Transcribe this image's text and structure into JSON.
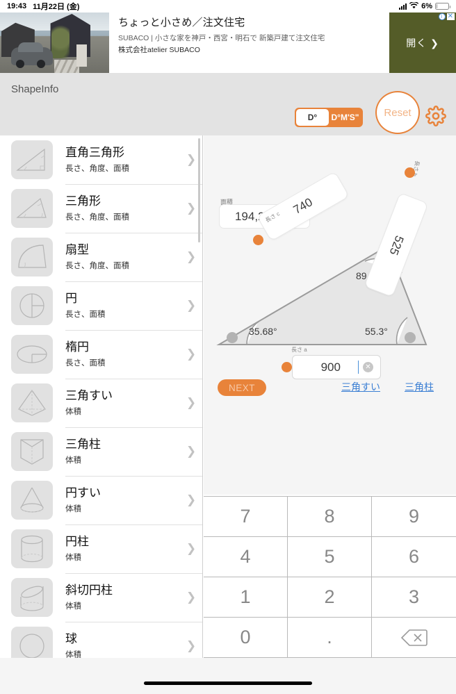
{
  "status_bar": {
    "time": "19:43",
    "date": "11月22日 (金)",
    "battery_percent": "6%",
    "signal_icon": "cellular-signal-icon",
    "wifi_icon": "wifi-icon",
    "battery_icon": "battery-icon"
  },
  "ad": {
    "title": "ちょっと小さめ／注文住宅",
    "description": "SUBACO | 小さな家を神戸・西宮・明石で 新築戸建て注文住宅",
    "advertiser": "株式会社atelier SUBACO",
    "cta_label": "開く ❯",
    "info_badge": "i",
    "close_badge": "✕",
    "cta_color": "#545c28"
  },
  "header": {
    "app_title": "ShapeInfo",
    "angle_mode": {
      "options": [
        "D°",
        "D°M'S\""
      ],
      "selected": "D°"
    },
    "reset_label": "Reset",
    "settings_icon": "gear-icon",
    "accent_color": "#e8833a"
  },
  "sidebar": {
    "items": [
      {
        "title": "直角三角形",
        "subtitle": "長さ、角度、面積",
        "icon": "right-triangle-icon"
      },
      {
        "title": "三角形",
        "subtitle": "長さ、角度、面積",
        "icon": "triangle-icon"
      },
      {
        "title": "扇型",
        "subtitle": "長さ、角度、面積",
        "icon": "sector-icon"
      },
      {
        "title": "円",
        "subtitle": "長さ、面積",
        "icon": "circle-icon"
      },
      {
        "title": "楕円",
        "subtitle": "長さ、面積",
        "icon": "ellipse-icon"
      },
      {
        "title": "三角すい",
        "subtitle": "体積",
        "icon": "triangular-pyramid-icon"
      },
      {
        "title": "三角柱",
        "subtitle": "体積",
        "icon": "triangular-prism-icon"
      },
      {
        "title": "円すい",
        "subtitle": "体積",
        "icon": "cone-icon"
      },
      {
        "title": "円柱",
        "subtitle": "体積",
        "icon": "cylinder-icon"
      },
      {
        "title": "斜切円柱",
        "subtitle": "体積",
        "icon": "oblique-cylinder-icon"
      },
      {
        "title": "球",
        "subtitle": "体積",
        "icon": "sphere-icon"
      }
    ],
    "chevron_icon": "chevron-right-icon"
  },
  "main": {
    "area_label": "面積",
    "area_value": "194,221.86",
    "angles": {
      "top_right": "89.02°",
      "bottom_left": "35.68°",
      "bottom_right": "55.3°"
    },
    "sides": {
      "c_label": "長さ c",
      "c_value": "740",
      "b_label": "長さ b",
      "b_value": "525",
      "a_label": "長さ a",
      "a_value": "900"
    },
    "clear_icon": "clear-field-icon",
    "next_label": "NEXT",
    "links": [
      {
        "label": "三角すい"
      },
      {
        "label": "三角柱"
      }
    ],
    "link_color": "#3b7fd4"
  },
  "keypad": {
    "keys": [
      "7",
      "8",
      "9",
      "4",
      "5",
      "6",
      "1",
      "2",
      "3",
      "0",
      ".",
      "⌫"
    ],
    "backspace_icon": "backspace-icon"
  }
}
